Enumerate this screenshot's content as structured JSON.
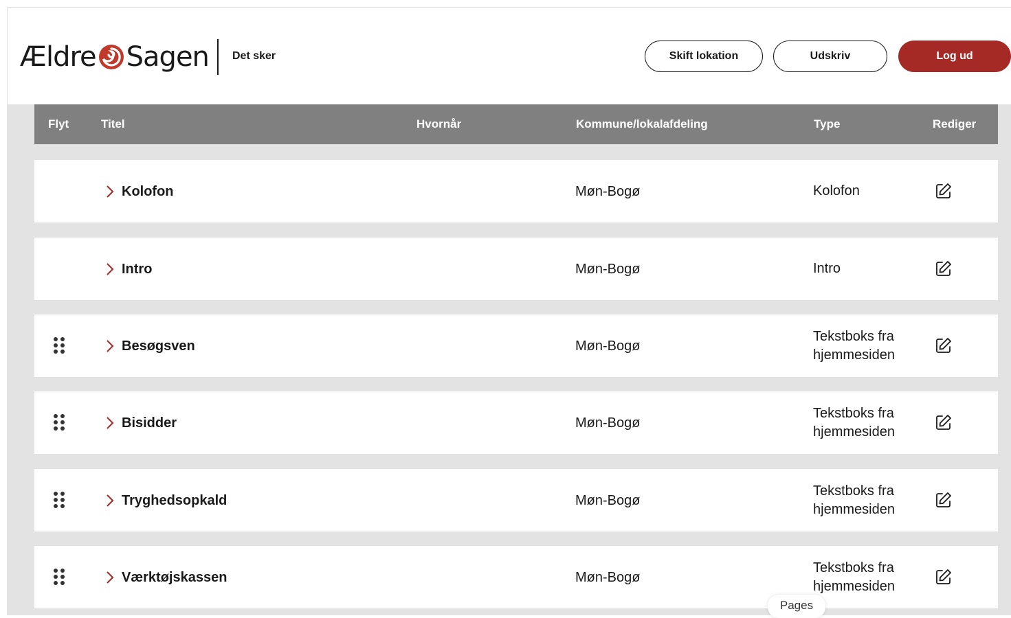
{
  "header": {
    "logo_text_left": "Ældre",
    "logo_text_right": "Sagen",
    "section_title": "Det sker",
    "buttons": {
      "change_location": "Skift lokation",
      "print": "Udskriv",
      "logout": "Log ud"
    }
  },
  "table": {
    "columns": {
      "move": "Flyt",
      "title": "Titel",
      "when": "Hvornår",
      "municipality": "Kommune/lokalafdeling",
      "type": "Type",
      "edit": "Rediger"
    },
    "rows": [
      {
        "title": "Kolofon",
        "when": "",
        "municipality": "Møn-Bogø",
        "type": "Kolofon",
        "draggable": false
      },
      {
        "title": "Intro",
        "when": "",
        "municipality": "Møn-Bogø",
        "type": "Intro",
        "draggable": false
      },
      {
        "title": "Besøgsven",
        "when": "",
        "municipality": "Møn-Bogø",
        "type": "Tekstboks fra hjemmesiden",
        "draggable": true
      },
      {
        "title": "Bisidder",
        "when": "",
        "municipality": "Møn-Bogø",
        "type": "Tekstboks fra hjemmesiden",
        "draggable": true
      },
      {
        "title": "Tryghedsopkald",
        "when": "",
        "municipality": "Møn-Bogø",
        "type": "Tekstboks fra hjemmesiden",
        "draggable": true
      },
      {
        "title": "Værktøjskassen",
        "when": "",
        "municipality": "Møn-Bogø",
        "type": "Tekstboks fra hjemmesiden",
        "draggable": true
      }
    ]
  },
  "pages_label": "Pages",
  "colors": {
    "brand_red": "#a52a25",
    "header_gray": "#808080",
    "background_gray": "#e3e3e3"
  },
  "icons": {
    "expand": "chevron-right-icon",
    "move": "drag-handle-icon",
    "edit": "edit-icon"
  }
}
